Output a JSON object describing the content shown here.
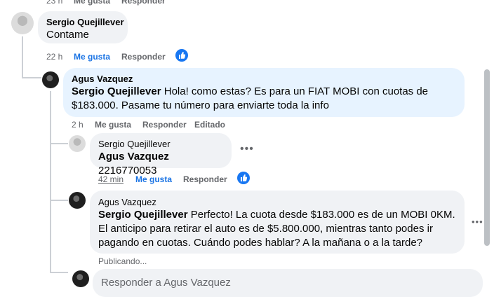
{
  "top_partial": {
    "time": "23 h",
    "like": "Me gusta",
    "reply": "Responder"
  },
  "comment1": {
    "author": "Sergio Quejillever",
    "text": "Contame",
    "time": "22 h",
    "like": "Me gusta",
    "reply": "Responder"
  },
  "reply1": {
    "author": "Agus Vazquez",
    "mention": "Sergio Quejillever",
    "text": " Hola! como estas? Es para un FIAT MOBI con cuotas de $183.000. Pasame tu número para enviarte toda la info",
    "time": "2 h",
    "like": "Me gusta",
    "reply": "Responder",
    "edited": "Editado"
  },
  "reply2": {
    "author": "Sergio Quejillever",
    "mention": "Agus Vazquez",
    "text": " 2216770053",
    "time": "42 min",
    "like": "Me gusta",
    "reply": "Responder"
  },
  "reply3": {
    "author": "Agus Vazquez",
    "mention": "Sergio Quejillever",
    "text": " Perfecto! La cuota desde $183.000 es de un MOBI 0KM. El anticipo para retirar el auto es de $5.800.000, mientras tanto podes ir pagando en cuotas. Cuándo podes hablar? A la mañana o a la tarde?",
    "status": "Publicando..."
  },
  "composer": {
    "placeholder": "Responder a Agus Vazquez"
  },
  "colors": {
    "accent": "#1877f2",
    "bubble": "#f0f2f5",
    "highlight": "#e7f3ff"
  },
  "icons": [
    "thumbs-up-icon",
    "more-options-icon"
  ]
}
